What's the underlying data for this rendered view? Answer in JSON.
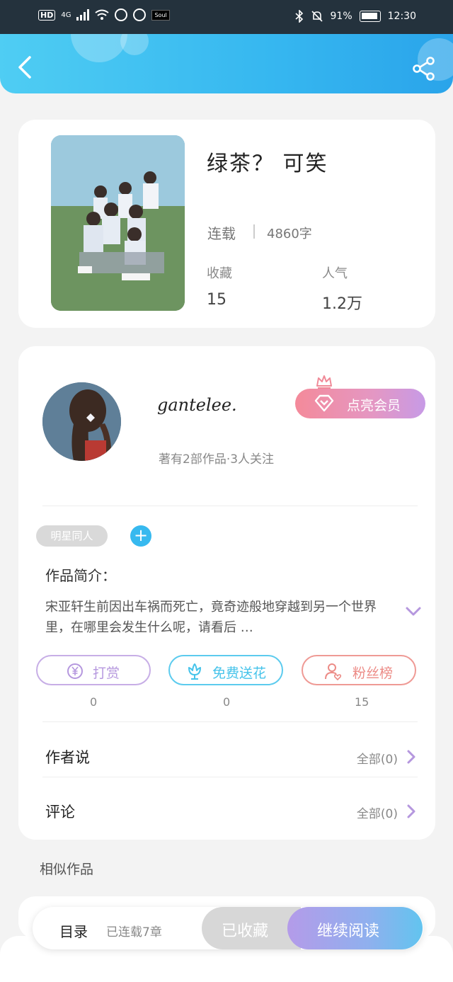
{
  "status_bar": {
    "network": "4G",
    "battery": "91%",
    "time": "12:30",
    "hd_label": "HD",
    "soul_label": "Soul"
  },
  "header": {
    "back_icon": "chevron-left-icon",
    "share_icon": "share-icon"
  },
  "book": {
    "title": "绿茶？ 可笑",
    "status": "连载",
    "word_count": "4860字",
    "favorites_label": "收藏",
    "favorites_value": "15",
    "popularity_label": "人气",
    "popularity_value": "1.2万"
  },
  "author": {
    "name": "gantelee.",
    "meta": "著有2部作品·3人关注",
    "vip_button": "点亮会员"
  },
  "tags": {
    "items": [
      "明星同人"
    ],
    "add_label": "+"
  },
  "intro": {
    "label": "作品简介：",
    "text": "宋亚轩生前因出车祸而死亡，竟奇迹般地穿越到另一个世界里，在哪里会发生什么呢，请看后 …"
  },
  "actions": [
    {
      "label": "打赏",
      "count": "0",
      "icon": "yen-coin-icon",
      "color": "#b597de"
    },
    {
      "label": "免费送花",
      "count": "0",
      "icon": "flower-icon",
      "color": "#45c3ea"
    },
    {
      "label": "粉丝榜",
      "count": "15",
      "icon": "fan-user-icon",
      "color": "#ec8b86"
    }
  ],
  "rows": {
    "author_says": {
      "label": "作者说",
      "value": "全部(0)"
    },
    "comments": {
      "label": "评论",
      "value": "全部(0)"
    }
  },
  "similar_label": "相似作品",
  "bottom_bar": {
    "toc_label": "目录",
    "chapters_label": "已连载7章",
    "favorited_button": "已收藏",
    "continue_button": "继续阅读"
  },
  "colors": {
    "header_gradient_start": "#4fcdf3",
    "header_gradient_end": "#2aa4ea",
    "accent_purple": "#b597de"
  }
}
